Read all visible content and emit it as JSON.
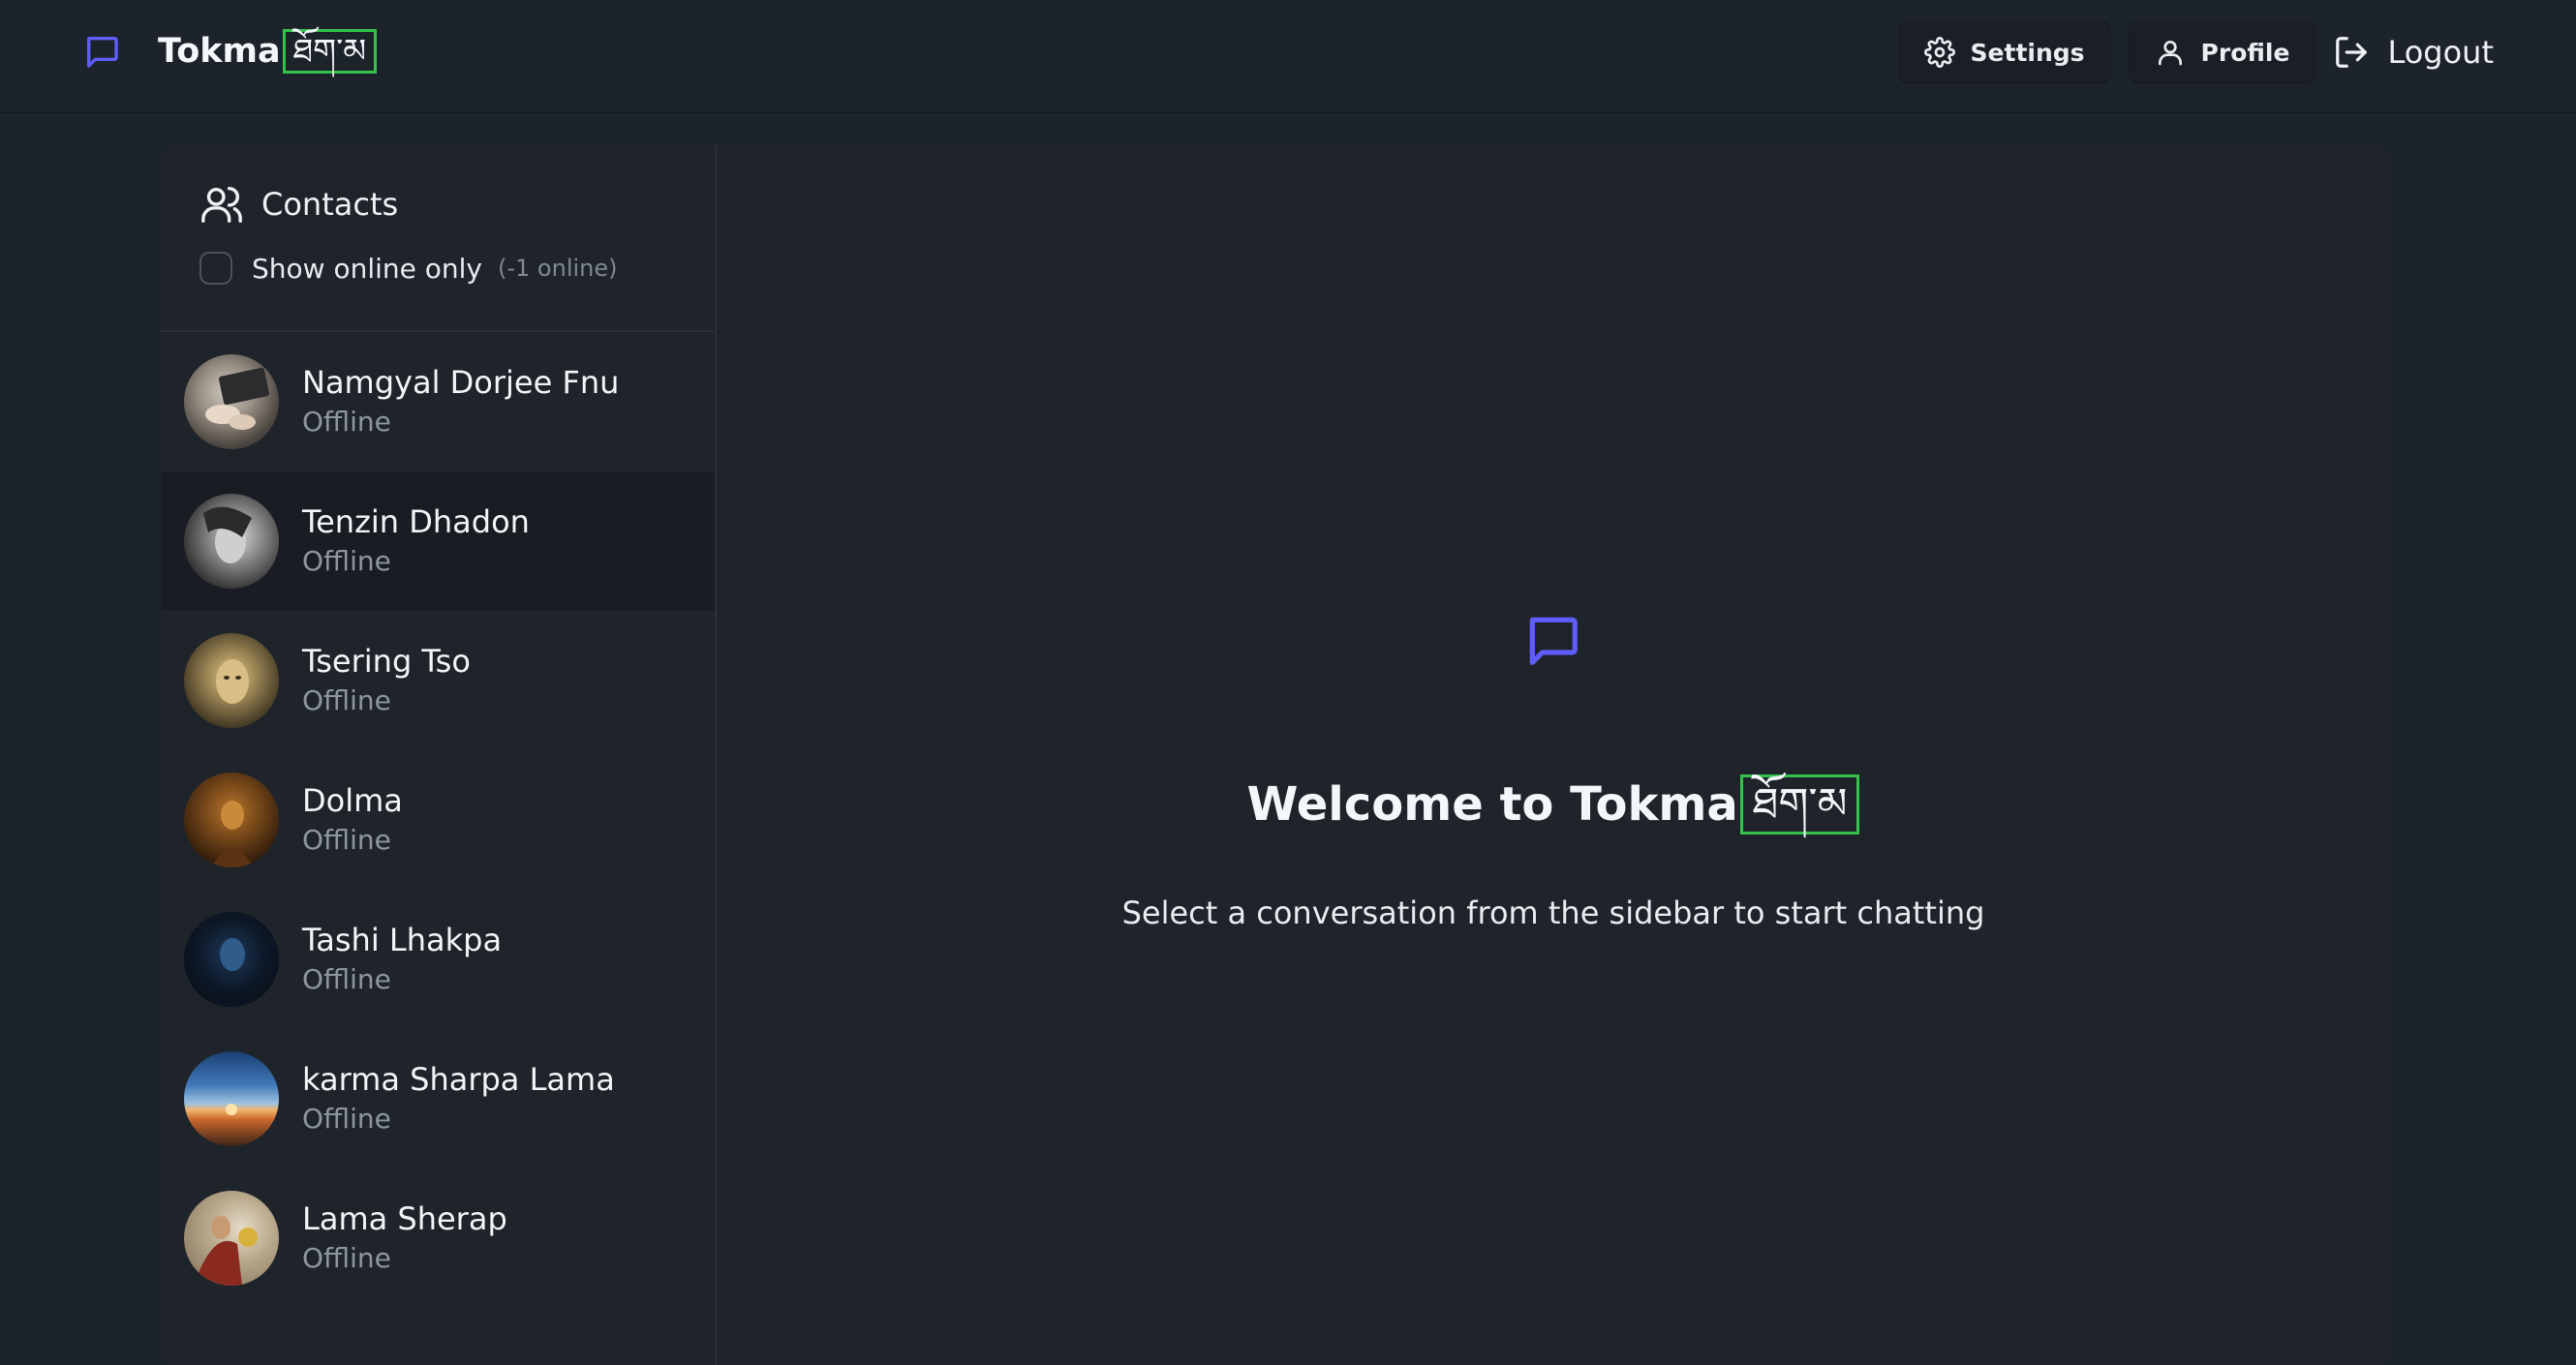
{
  "navbar": {
    "brand": "Tokma",
    "brand_tibetan": "ཐོག་མ",
    "settings_label": "Settings",
    "profile_label": "Profile",
    "logout_label": "Logout"
  },
  "sidebar": {
    "title": "Contacts",
    "filter_label": "Show online only",
    "online_count": "(-1 online)",
    "contacts": [
      {
        "name": "Namgyal Dorjee Fnu",
        "status": "Offline",
        "avatar": "laptop-hands-photo"
      },
      {
        "name": "Tenzin Dhadon",
        "status": "Offline",
        "avatar": "bw-portrait-photo"
      },
      {
        "name": "Tsering Tso",
        "status": "Offline",
        "avatar": "golden-portrait-photo"
      },
      {
        "name": "Dolma",
        "status": "Offline",
        "avatar": "dark-amber-photo"
      },
      {
        "name": "Tashi Lhakpa",
        "status": "Offline",
        "avatar": "dark-blue-portrait-photo"
      },
      {
        "name": "karma Sharpa Lama",
        "status": "Offline",
        "avatar": "sunset-photo"
      },
      {
        "name": "Lama Sherap",
        "status": "Offline",
        "avatar": "monk-photo"
      }
    ]
  },
  "main": {
    "welcome_title": "Welcome to Tokma",
    "welcome_tibetan": "ཐོག་མ",
    "welcome_subtitle": "Select a conversation from the sidebar to start chatting"
  },
  "colors": {
    "background": "#1d232a",
    "panel": "#1f242b",
    "accent": "#605dff",
    "highlight_box": "#35c24a",
    "muted_text": "#8d96a0"
  }
}
